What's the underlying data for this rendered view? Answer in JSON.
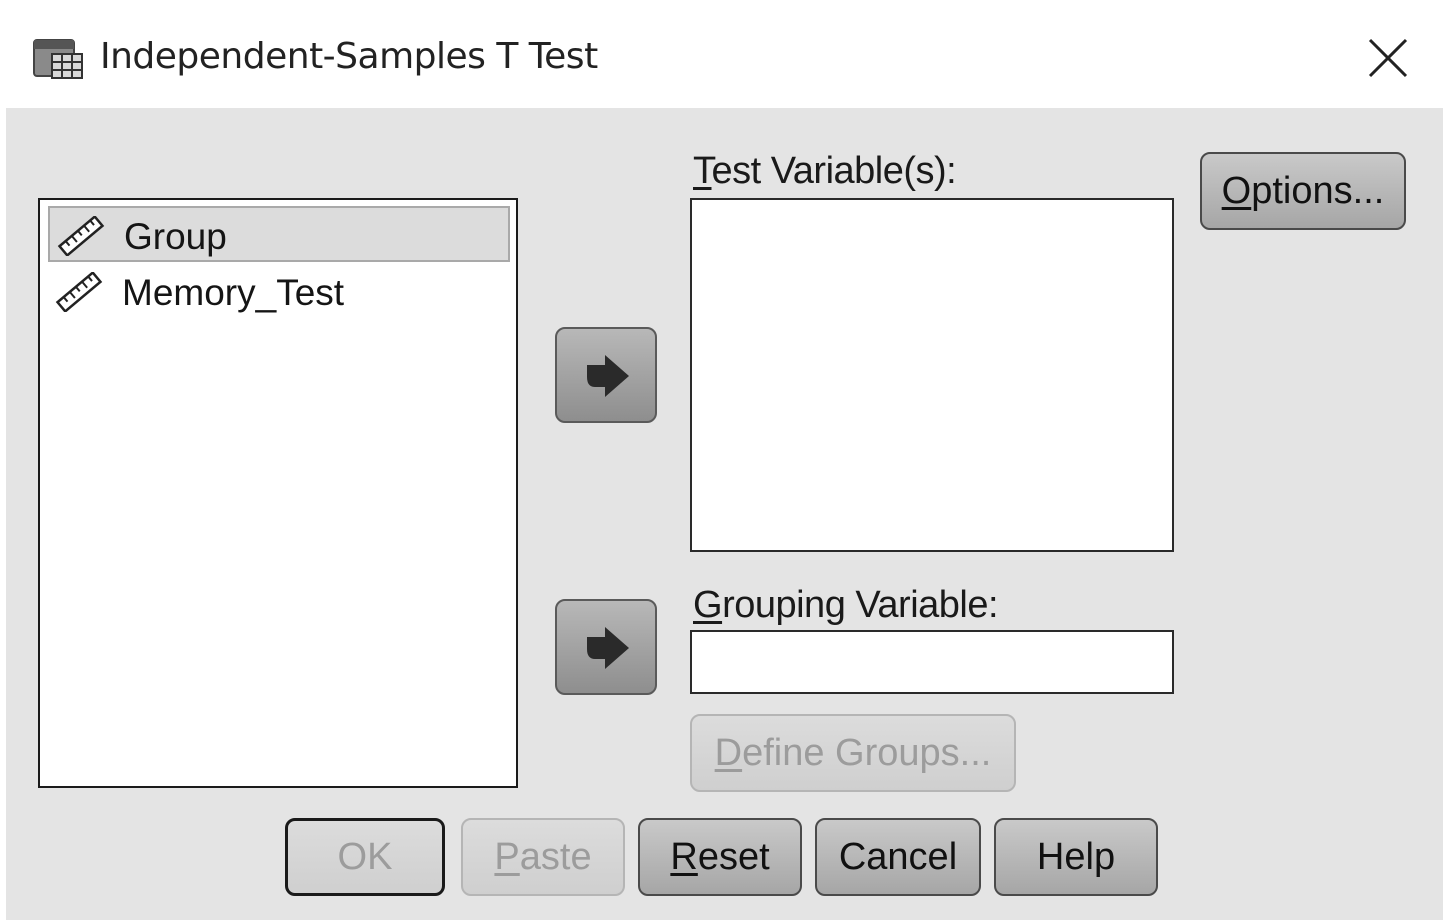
{
  "window": {
    "title": "Independent-Samples T Test",
    "icon": "spreadsheet-dialog-icon",
    "close_icon": "close-icon"
  },
  "source_variables": [
    {
      "label": "Group",
      "icon": "ruler-icon",
      "selected": true
    },
    {
      "label": "Memory_Test",
      "icon": "ruler-icon",
      "selected": false
    }
  ],
  "test_variables": {
    "label_first": "T",
    "label_rest": "est Variable(s):",
    "items": []
  },
  "grouping_variable": {
    "label_first": "G",
    "label_rest": "rouping Variable:",
    "value": ""
  },
  "buttons": {
    "options": {
      "first": "O",
      "rest": "ptions...",
      "enabled": true
    },
    "define_groups": {
      "first": "D",
      "rest": "efine Groups...",
      "enabled": false
    },
    "ok": {
      "label": "OK",
      "enabled": false
    },
    "paste": {
      "first": "P",
      "rest": "aste",
      "enabled": false
    },
    "reset": {
      "first": "R",
      "rest": "eset",
      "enabled": true
    },
    "cancel": {
      "label": "Cancel",
      "enabled": true
    },
    "help": {
      "label": "Help",
      "enabled": true
    }
  },
  "colors": {
    "dialog_bg": "#e4e4e4",
    "button_enabled": "#b8b8b8",
    "button_disabled": "#d6d6d6",
    "disabled_text": "#9c9c9c"
  }
}
